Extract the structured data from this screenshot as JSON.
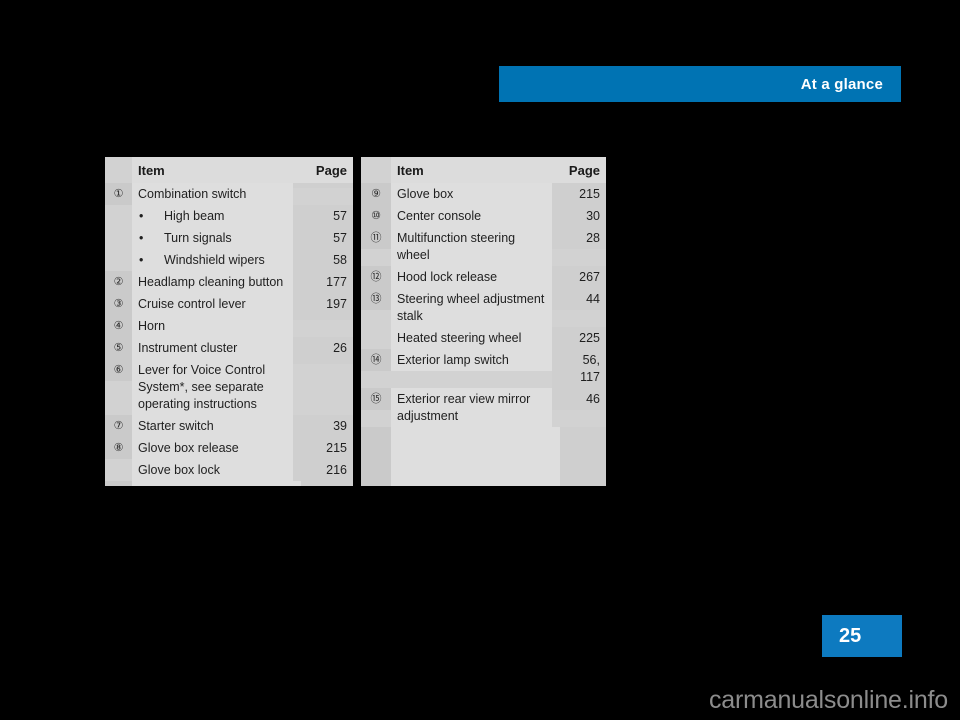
{
  "header": {
    "title": "At a glance",
    "banner_color": "#0073b3"
  },
  "page": {
    "number": "25",
    "number_block_color": "#0d7ac0"
  },
  "watermark": {
    "text": "carmanualsonline.info"
  },
  "tables": [
    {
      "name": "left-table",
      "columns": {
        "number": "",
        "item": "Item",
        "page": "Page"
      },
      "rows": [
        {
          "num": "①",
          "item": "Combination switch",
          "page": "",
          "bullet": false
        },
        {
          "num": "",
          "item": "High beam",
          "page": "57",
          "bullet": true
        },
        {
          "num": "",
          "item": "Turn signals",
          "page": "57",
          "bullet": true
        },
        {
          "num": "",
          "item": "Windshield wipers",
          "page": "58",
          "bullet": true
        },
        {
          "num": "②",
          "item": "Headlamp cleaning button",
          "page": "177",
          "bullet": false
        },
        {
          "num": "③",
          "item": "Cruise control lever",
          "page": "197",
          "bullet": false
        },
        {
          "num": "④",
          "item": "Horn",
          "page": "",
          "bullet": false
        },
        {
          "num": "⑤",
          "item": "Instrument cluster",
          "page": "26",
          "bullet": false
        },
        {
          "num": "⑥",
          "item": "Lever for Voice Control System*, see separate operating instructions",
          "page": "",
          "bullet": false
        },
        {
          "num": "⑦",
          "item": "Starter switch",
          "page": "39",
          "bullet": false
        },
        {
          "num": "⑧",
          "item": "Glove box release",
          "page": "215",
          "bullet": false
        },
        {
          "num": "",
          "item": "Glove box lock",
          "page": "216",
          "bullet": false
        }
      ]
    },
    {
      "name": "right-table",
      "columns": {
        "number": "",
        "item": "Item",
        "page": "Page"
      },
      "rows": [
        {
          "num": "⑨",
          "item": "Glove box",
          "page": "215",
          "bullet": false
        },
        {
          "num": "⑩",
          "item": "Center console",
          "page": "30",
          "bullet": false
        },
        {
          "num": "⑪",
          "item": "Multifunction steering wheel",
          "page": "28",
          "bullet": false
        },
        {
          "num": "⑫",
          "item": "Hood lock release",
          "page": "267",
          "bullet": false
        },
        {
          "num": "⑬",
          "item": "Steering wheel adjustment stalk",
          "page": "44",
          "bullet": false
        },
        {
          "num": "",
          "item": "Heated steering wheel",
          "page": "225",
          "bullet": false
        },
        {
          "num": "⑭",
          "item": "Exterior lamp switch",
          "page": "56,\n117",
          "bullet": false
        },
        {
          "num": "⑮",
          "item": "Exterior rear view mirror adjustment",
          "page": "46",
          "bullet": false
        }
      ]
    }
  ]
}
